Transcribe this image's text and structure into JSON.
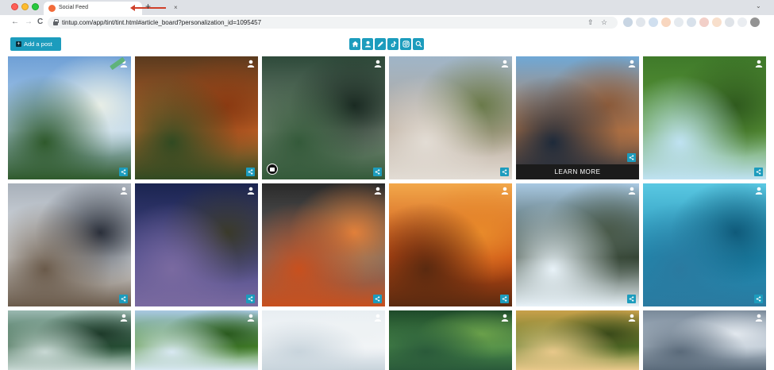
{
  "browser": {
    "tab_title": "Social Feed",
    "tab_close": "×",
    "new_tab": "+",
    "tab_menu": "⌄",
    "url": "tintup.com/app/tint/tint.html#article_board?personalization_id=1095457",
    "back": "←",
    "forward": "→",
    "reload": "C"
  },
  "toolbar": {
    "add_post_label": "Add a post",
    "add_post_icon": "+",
    "filters": [
      "home-icon",
      "user-icon",
      "pencil-icon",
      "tiktok-icon",
      "instagram-icon",
      "search-icon"
    ]
  },
  "tiles": [
    {
      "name": "meadow-cabin",
      "colors": [
        "#6fa0d6",
        "#b8d4ee",
        "#2f5a2c",
        "#e8eee6"
      ]
    },
    {
      "name": "autumn-forest-aerial",
      "colors": [
        "#5a3a1e",
        "#c8692a",
        "#314a22",
        "#8a3a12"
      ]
    },
    {
      "name": "mountain-road-coast",
      "colors": [
        "#2e4a3a",
        "#7a8a7a",
        "#345a3a",
        "#1a2a22"
      ]
    },
    {
      "name": "eroded-hills",
      "colors": [
        "#9fb5c8",
        "#b8a898",
        "#e2dcd4",
        "#6a7a4a"
      ]
    },
    {
      "name": "lake-reflection",
      "colors": [
        "#6fa8d6",
        "#c8804a",
        "#1e2a3a",
        "#8a5a3a"
      ]
    },
    {
      "name": "river-through-forest",
      "colors": [
        "#3f7a2a",
        "#5f9a3a",
        "#bfe2f2",
        "#2f5a1e"
      ]
    },
    {
      "name": "snowy-range",
      "colors": [
        "#a8b0ba",
        "#e8ecef",
        "#6a5a4a",
        "#2a2f3a"
      ]
    },
    {
      "name": "milky-way",
      "colors": [
        "#1a2450",
        "#4a4a8a",
        "#7a6aa0",
        "#3a3a2a"
      ]
    },
    {
      "name": "red-desert-storm",
      "colors": [
        "#2a2a2a",
        "#6a6a6a",
        "#c8501e",
        "#e2803a"
      ]
    },
    {
      "name": "sunlit-pine-forest",
      "colors": [
        "#f2a84a",
        "#c84a12",
        "#5a2a10",
        "#e88a2a"
      ]
    },
    {
      "name": "waterfall-cliffs",
      "colors": [
        "#a8c8e2",
        "#2a3a2a",
        "#e8f2f8",
        "#4a5a4a"
      ]
    },
    {
      "name": "tropical-island",
      "colors": [
        "#5ac8e2",
        "#1e8ab0",
        "#2a7aa0",
        "#0f5a7a"
      ]
    },
    {
      "name": "misty-jungle",
      "colors": [
        "#9ab8b0",
        "#2a5a3a",
        "#c8d8d4",
        "#1e3a2a"
      ]
    },
    {
      "name": "lone-tree",
      "colors": [
        "#a8c8e2",
        "#4a8a2a",
        "#d8e8f2",
        "#2a5a1e"
      ]
    },
    {
      "name": "foggy-white",
      "colors": [
        "#e8eef2",
        "#f4f6f8",
        "#c8d4dc",
        "#eef2f4"
      ]
    },
    {
      "name": "green-valley",
      "colors": [
        "#1e4a2a",
        "#4a8a4a",
        "#2a5a3a",
        "#6aa04a"
      ]
    },
    {
      "name": "golden-canopy",
      "colors": [
        "#c8a04a",
        "#5a7a2a",
        "#e8c88a",
        "#3a4a1a"
      ]
    },
    {
      "name": "cloudy-shore",
      "colors": [
        "#7a8a9a",
        "#b8c4d0",
        "#5a6a7a",
        "#e2e8ee"
      ]
    }
  ],
  "learn_more_label": "LEARN MORE"
}
